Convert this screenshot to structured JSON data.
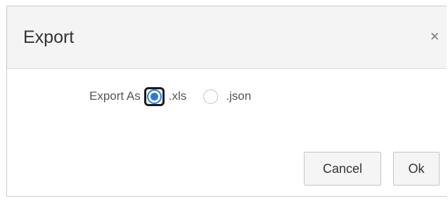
{
  "dialog": {
    "title": "Export",
    "close_glyph": "×"
  },
  "export_as": {
    "label": "Export As",
    "options": [
      {
        "label": ".xls",
        "selected": true
      },
      {
        "label": ".json",
        "selected": false
      }
    ]
  },
  "buttons": {
    "cancel_label": "Cancel",
    "ok_label": "Ok"
  },
  "colors": {
    "accent": "#2a7bd6",
    "header_bg": "#f4f4f4",
    "button_bg": "#f5f5f5"
  }
}
